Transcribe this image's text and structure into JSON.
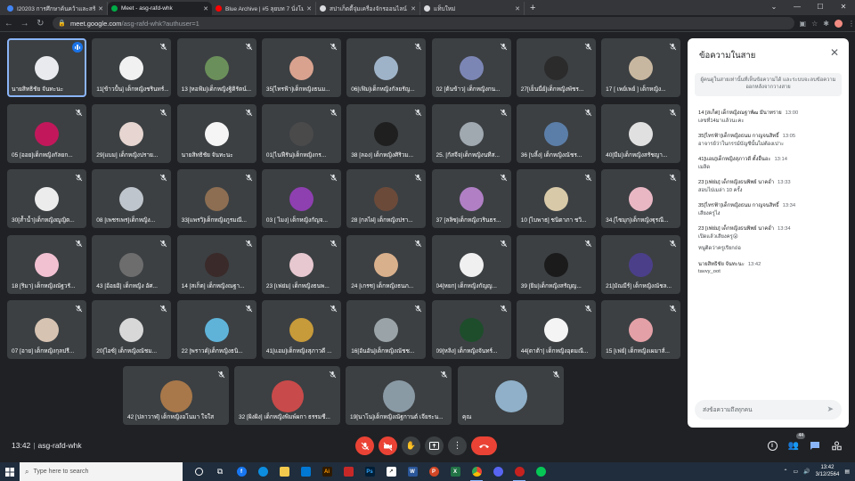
{
  "browser": {
    "tabs": [
      {
        "title": "I20203 การศึกษาค้นคว้าและสร้างองค์ความรู้",
        "fav_color": "#4285f4",
        "active": false
      },
      {
        "title": "Meet - asg-rafd-whk",
        "fav_color": "#00ac47",
        "active": true
      },
      {
        "title": "Blue Archive | #5 ลุยบท 7 นั่งโมแบบ",
        "fav_color": "#ff0000",
        "active": false
      },
      {
        "title": "สปาเก็ตตี้จุ่มเครื่องจักรออนไลน์ - ค้นหาด้วย Google",
        "fav_color": "#dadce0",
        "active": false
      },
      {
        "title": "แท็บใหม่",
        "fav_color": "#dadce0",
        "active": false
      }
    ],
    "new_tab": "+",
    "url_host": "meet.google.com",
    "url_path": "/asg-rafd-whk?authuser=1"
  },
  "tiles": [
    {
      "name": "นายสิทธิชัย จันทะนะ",
      "color": "#e8eaed",
      "state": "speaking"
    },
    {
      "name": "11[ข้าวปั้น] เด็กหญิงชรินทร์...",
      "color": "#f1f1f1",
      "state": "muted"
    },
    {
      "name": "13 [หอฟ้ม]เด็กหญิงฐิติรัตน์...",
      "color": "#6b8f5a",
      "state": "muted"
    },
    {
      "name": "35[ไทรฟ้า]เด็กหญิงธนม...",
      "color": "#d9a28f",
      "state": "muted"
    },
    {
      "name": "06[เฟิม]เด็กหญิงกัลยรัญ...",
      "color": "#9fb3c8",
      "state": "muted"
    },
    {
      "name": "02 [ต้นข้าว] เด็กหญิงกน...",
      "color": "#7c86b5",
      "state": "muted"
    },
    {
      "name": "27[เย็นนี่ย์]เด็กหญิงพัชร...",
      "color": "#2b2b2b",
      "state": "muted"
    },
    {
      "name": "17 [ เพย์เพย์ ] เด็กหญิง...",
      "color": "#c8b7a0",
      "state": "muted"
    },
    {
      "name": "05 [ออย]เด็กหญิงกัลยก...",
      "color": "#c2185b",
      "state": "muted"
    },
    {
      "name": "29[แบม] เด็กหญิงปราย...",
      "color": "#e6d5d0",
      "state": "muted"
    },
    {
      "name": "นายสิทธิชัย จันทะนะ",
      "color": "#f5f5f5",
      "state": "muted"
    },
    {
      "name": "01[ไนฟีรัน]เด็กหญิงกร...",
      "color": "#4a4a4a",
      "state": "muted"
    },
    {
      "name": "38 [ลอง] เด็กหญิงศิริวม...",
      "color": "#1f1f1f",
      "state": "muted"
    },
    {
      "name": "25. [กัสจีจ]เด็กหญิงนทีส...",
      "color": "#a0a8b0",
      "state": "muted"
    },
    {
      "name": "36 [บลิ้ง] เด็กหญิงณัชร...",
      "color": "#5b7ea8",
      "state": "muted"
    },
    {
      "name": "40[มีม]เด็กหญิงสรัชญา...",
      "color": "#e0e0e0",
      "state": "muted"
    },
    {
      "name": "30[ส้ำน้ำ]เด็กหญิงญูญิต...",
      "color": "#ececec",
      "state": "muted"
    },
    {
      "name": "08 [เพชรเพร]เด็กหญิง...",
      "color": "#bfc5cc",
      "state": "muted"
    },
    {
      "name": "33[แพรวิ]เด็กหญิงภูรมณี...",
      "color": "#8d6e52",
      "state": "muted"
    },
    {
      "name": "03 [ ไมง] เด็กหญิงกัญจ...",
      "color": "#8e3fb0",
      "state": "muted"
    },
    {
      "name": "28 [กลไฝ] เด็กหญิงปรา...",
      "color": "#6b4a3a",
      "state": "muted"
    },
    {
      "name": "37 [ลลิซ]เด็กหญิงวรินธร...",
      "color": "#b07fc4",
      "state": "muted"
    },
    {
      "name": "10 [ไบพาธ] ชนิดาภา ชวิ...",
      "color": "#d8c9a8",
      "state": "muted"
    },
    {
      "name": "34.[ไซมุก]เด็กหญิงฐุรณี...",
      "color": "#e9b7c4",
      "state": "muted"
    },
    {
      "name": "18 [ริมา] เด็กหญิงณัฐวรั...",
      "color": "#f2c1d1",
      "state": "muted"
    },
    {
      "name": "43 [อ้อยอิ] เด็กหญิง อัศ...",
      "color": "#6d6d6d",
      "state": "muted"
    },
    {
      "name": "14 [สเก็ต] เด็กหญิงณฐา...",
      "color": "#3a2a2a",
      "state": "muted"
    },
    {
      "name": "23 [เฟย่ม] เด็กหญิงธนพ...",
      "color": "#e7c8d0",
      "state": "muted"
    },
    {
      "name": "24 [เกรซ] เด็กหญิงธนภ...",
      "color": "#d9b08c",
      "state": "muted"
    },
    {
      "name": "04[หยก] เด็กหญิงกัญญ...",
      "color": "#f0f0f0",
      "state": "muted"
    },
    {
      "name": "39 [ยิม]เด็กหญิงสรัญญ...",
      "color": "#1b1b1b",
      "state": "muted"
    },
    {
      "name": "21[มัณมีร์] เด็กหญิงณัชล...",
      "color": "#4b3f8a",
      "state": "muted"
    },
    {
      "name": "07 [อาย] เด็กหญิงกุลปรี...",
      "color": "#d7c3b2",
      "state": "muted"
    },
    {
      "name": "20[ไอซ์] เด็กหญิงณัชม...",
      "color": "#d8d8d8",
      "state": "muted"
    },
    {
      "name": "22 [พราวด์]เด็กหญิงธนิ...",
      "color": "#5fb3d9",
      "state": "muted"
    },
    {
      "name": "41[แอม]เด็กหญิงสุภาวดี ...",
      "color": "#c79a3a",
      "state": "muted"
    },
    {
      "name": "16[อันอัน]เด็กหญิงณัชช...",
      "color": "#9aa3a8",
      "state": "muted"
    },
    {
      "name": "09[หลิง] เด็กหญิงจันทร์...",
      "color": "#1e4d2b",
      "state": "muted"
    },
    {
      "name": "44[ดาต้า] เด็กหญิงอุดมณี...",
      "color": "#f4f4f4",
      "state": "muted"
    },
    {
      "name": "15 [เฟย์] เด็กหญิงเผมาส์...",
      "color": "#e3a0a6",
      "state": "muted"
    },
    {
      "name": "42 [ปลาวาฬ] เด็กหญิงอโนมา ใจใส",
      "color": "#a8784a",
      "state": "muted"
    },
    {
      "name": "32 [ผิงผิง] เด็กหญิงพิมพ์ผกา ธรรมชี...",
      "color": "#c94a4a",
      "state": "muted"
    },
    {
      "name": "19[นาโน]เด็กหญิงณัฐกานต์ เจียระน...",
      "color": "#8a9aa5",
      "state": "muted"
    },
    {
      "name": "คุณ",
      "color": "#8fb0c8",
      "state": "muted"
    }
  ],
  "chat": {
    "title": "ข้อความในสาย",
    "note": "ผู้คนดูในสายเท่านั้นที่เห็นข้อความได้ และระบบจะลบข้อความออกหลังจากวางสาย",
    "messages": [
      {
        "who": "14 [สเก็ต] เด็กหญิงณฐาพัฒ มีนาทราย",
        "time": "13:00",
        "lines": [
          "เลขที่14มาแล้วนะคะ"
        ]
      },
      {
        "who": "35[ไทรฟ้า]เด็กหญิงธนม กาญจนสิทธิ์",
        "time": "13:05",
        "lines": [
          "อาจารย์ว่าในกรรม์บัญชีนั้นไม่ต้องเปาะ"
        ]
      },
      {
        "who": "41[แอม]เด็กหญิงสุภาวดี ตั้งอื่นอะ",
        "time": "13:14",
        "lines": [
          "เมลิด"
        ]
      },
      {
        "who": "23 [เฟย่ม] เด็กหญิงธนพิพย์ นาคอ่ำ",
        "time": "13:33",
        "lines": [
          "สอบไปเมล่า 10 ครั้ง"
        ]
      },
      {
        "who": "35[ไทรฟ้า]เด็กหญิงธนม กาญจนสิทธิ์",
        "time": "13:34",
        "lines": [
          "เสียงครูไง"
        ]
      },
      {
        "who": "23 [เฟย่ม] เด็กหญิงธนพิพย์ นาคอ่ำ",
        "time": "13:34",
        "lines": [
          "เปิดแล้วเสียงครู😮",
          "หนูติดว่าครูเรียกถ่อ"
        ]
      },
      {
        "who": "นายสิทธิชัย จันทะนะ",
        "time": "13:42",
        "lines": [
          "tavvy_oot"
        ]
      }
    ],
    "compose_placeholder": "ส่งข้อความถึงทุกคน",
    "send_icon": "send-icon"
  },
  "bottom": {
    "time": "13:42",
    "separator": "|",
    "meeting_code": "asg-rafd-whk",
    "participants_count": "44"
  },
  "taskbar": {
    "search_placeholder": "Type here to search",
    "time": "13:42",
    "date": "3/12/2564"
  }
}
